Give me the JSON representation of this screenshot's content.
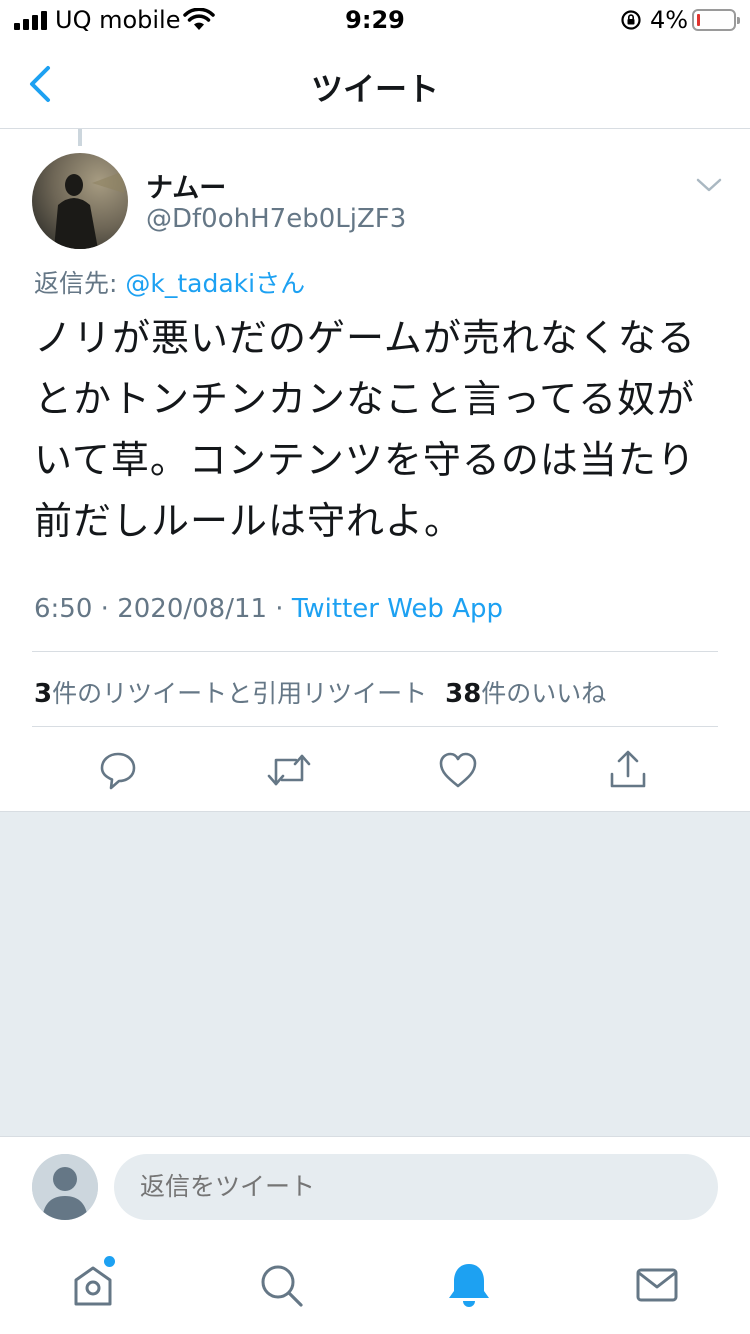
{
  "status_bar": {
    "carrier": "UQ mobile",
    "time": "9:29",
    "battery_percent": "4%",
    "battery_level": 0.04,
    "icons": [
      "signal-icon",
      "wifi-icon",
      "rotation-lock-icon",
      "battery-icon"
    ]
  },
  "header": {
    "title": "ツイート",
    "back_icon": "chevron-left-icon"
  },
  "tweet": {
    "display_name": "ナムー",
    "handle": "@Df0ohH7eb0LjZF3",
    "reply_prefix": "返信先: ",
    "reply_mention": "@k_tadaki",
    "reply_suffix": "さん",
    "text": "ノリが悪いだのゲームが売れなくなるとかトンチンカンなこと言ってる奴がいて草。コンテンツを守るのは当たり前だしルールは守れよ。",
    "time": "6:50",
    "date": "2020/08/11",
    "separator": " · ",
    "source_app": "Twitter Web App",
    "retweet_count": "3",
    "retweet_label": "件のリツイートと引用リツイート",
    "like_count": "38",
    "like_label": "件のいいね"
  },
  "actions": [
    "reply-icon",
    "retweet-icon",
    "like-icon",
    "share-icon"
  ],
  "composer": {
    "placeholder": "返信をツイート"
  },
  "tab_bar": [
    "home-icon",
    "search-icon",
    "notifications-icon",
    "messages-icon"
  ],
  "colors": {
    "accent": "#1da1f2",
    "secondary_text": "#657786",
    "divider": "#d8dde2",
    "background_grey": "#e6ecf0"
  }
}
